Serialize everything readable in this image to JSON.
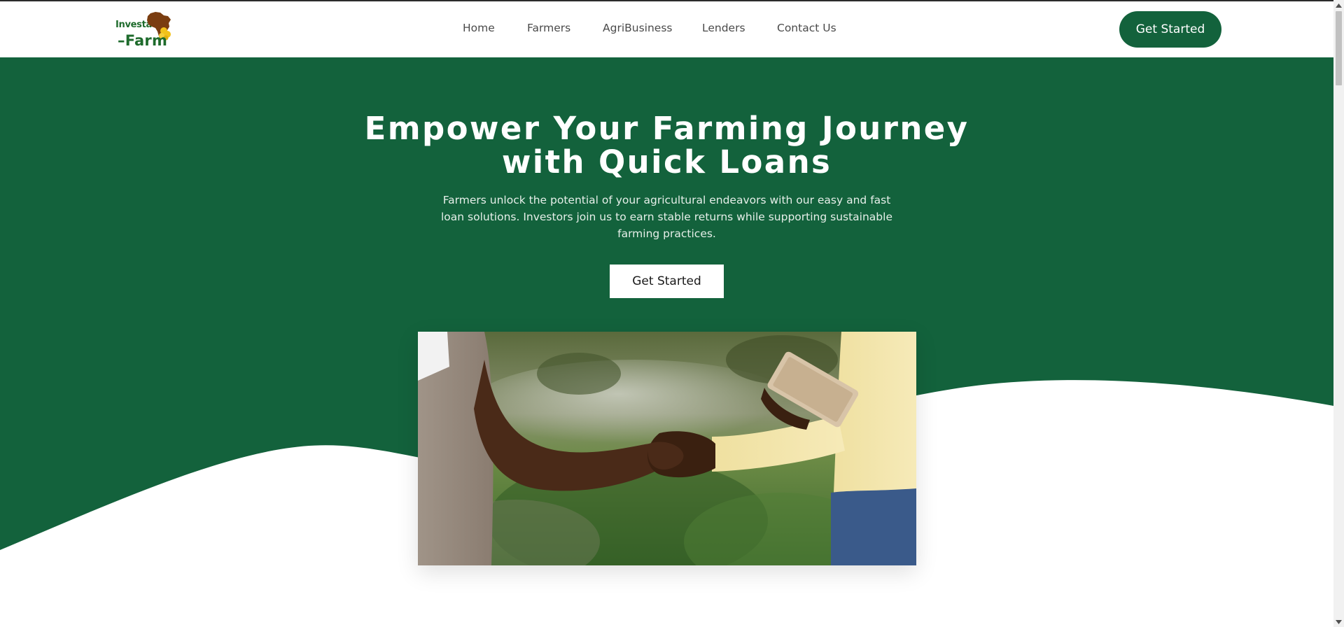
{
  "brand": {
    "logo_top": "Investa",
    "logo_bottom": "–Farm",
    "primary_color": "#13623c",
    "accent_color": "#7a3d10"
  },
  "nav": {
    "items": [
      {
        "label": "Home"
      },
      {
        "label": "Farmers"
      },
      {
        "label": "AgriBusiness"
      },
      {
        "label": "Lenders"
      },
      {
        "label": "Contact Us"
      }
    ]
  },
  "header": {
    "cta_label": "Get Started"
  },
  "hero": {
    "title": "Empower Your Farming Journey with Quick Loans",
    "subtitle": "Farmers unlock the potential of your agricultural endeavors with our easy and fast loan solutions. Investors join us to earn stable returns while supporting sustainable farming practices.",
    "cta_label": "Get Started",
    "background_color": "#13623c",
    "image": "handshake-photo"
  },
  "icons": {
    "logo_map": "africa-map-icon",
    "scroll_up": "scroll-up-arrow-icon",
    "scroll_down": "scroll-down-arrow-icon"
  }
}
